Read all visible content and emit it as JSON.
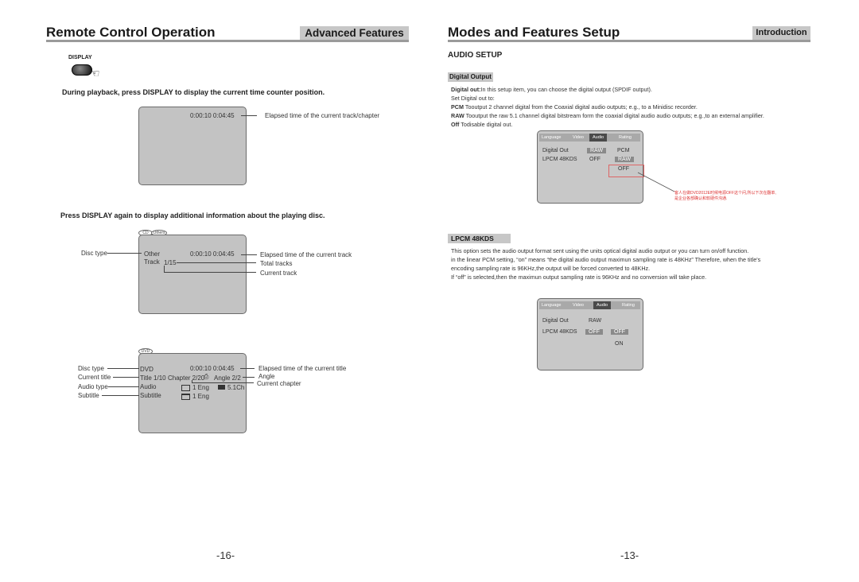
{
  "left_page": {
    "title": "Remote Control Operation",
    "tag": "Advanced Features",
    "display_button_label": "DISPLAY",
    "instruction_1": "During playback, press DISPLAY to display the current time counter position.",
    "screen1": {
      "time": "0:00:10  0:04:45",
      "annotation": "Elapsed time of the current track/chapter"
    },
    "instruction_2": "Press DISPLAY again to display additional information about the playing  disc.",
    "screen2": {
      "tabs": [
        "CD",
        "Others"
      ],
      "disc_type": "Other",
      "time": "0:00:10  0:04:45",
      "track_label": "Track",
      "track_value": "1/15",
      "left_labels": {
        "disc_type": "Disc type"
      },
      "right_labels": {
        "elapsed": "Elapsed time of the current track",
        "total": "Total tracks",
        "current": "Current track"
      }
    },
    "screen3": {
      "tab": "DVD",
      "disc_type": "DVD",
      "time": "0:00:10  0:04:45",
      "title": "Title 1/10",
      "chapter": "Chapter 2/20",
      "angle": "Angle  2/2",
      "audio_label": "Audio",
      "audio_value": "1 Eng",
      "audio_channels": "5.1Ch",
      "subtitle_label": "Subtitle",
      "subtitle_value": "1 Eng",
      "left_labels": {
        "disc_type": "Disc type",
        "current_title": "Current title",
        "audio_type": "Audio type",
        "subtitle": "Subtitle"
      },
      "right_labels": {
        "elapsed": "Elapsed time of the current title",
        "angle": "Angle",
        "current_chapter": "Current chapter"
      }
    },
    "page_number": "-16-"
  },
  "right_page": {
    "title": "Modes and Features Setup",
    "tag": "Introduction",
    "section_heading": "AUDIO SETUP",
    "digital_output": {
      "heading": "Digital Output",
      "lines": [
        {
          "bold": "Digital out:",
          "text": "In this setup item, you can choose the digital output (SPDIF output)."
        },
        {
          "bold": "",
          "text": "Set Digital out to:"
        },
        {
          "bold": "PCM",
          "text": " Tooutput 2 channel digital from  the Coaxial digital audio outputs; e.g., to a Minidisc recorder."
        },
        {
          "bold": "RAW",
          "text": " Tooutput the raw 5.1 channel digital bitstream  form  the coaxial digital audio audio outputs; e.g.,to an external amplifier."
        },
        {
          "bold": "Off",
          "text": " Todisable digital out."
        }
      ],
      "menu": {
        "tabs": [
          "Language",
          "Video",
          "Audio",
          "Rating"
        ],
        "active_tab": "Audio",
        "rows": [
          {
            "label": "Digital Out",
            "value": "RAW",
            "option": "PCM"
          },
          {
            "label": "LPCM 48KDS",
            "value": "OFF",
            "option": "RAW"
          }
        ],
        "extra_option": "OFF"
      },
      "red_note": [
        "客人在做DVD2012E时候电源OFF这个问,所以下次在翻单,",
        "是企业各部确认和软硬件沟通."
      ]
    },
    "lpcm": {
      "heading": "LPCM 48KDS",
      "lines": [
        "This option sets the audio output format sent using the units optical digital audio output or you can turn on/off function.",
        "in the linear PCM setting, “on” means  “the digital audio output maximun sampling rate is 48KHz”  Therefore, when the title's",
        "encoding sampling rate is 96KHz,the output will be forced converted to 48KHz.",
        "If  “off” is selected,then the maximun output sampling rate is 96KHz and no conversion will take place."
      ],
      "menu": {
        "tabs": [
          "Language",
          "Video",
          "Audio",
          "Rating"
        ],
        "active_tab": "Audio",
        "rows": [
          {
            "label": "Digital Out",
            "value": "RAW",
            "option": ""
          },
          {
            "label": "LPCM 48KDS",
            "value": "OFF",
            "option": "OFF"
          }
        ],
        "extra_option": "ON"
      }
    },
    "page_number": "-13-"
  }
}
